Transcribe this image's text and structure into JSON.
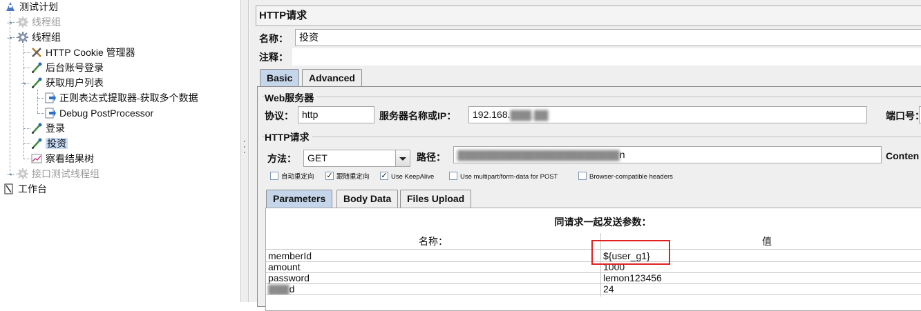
{
  "tree": {
    "items": [
      {
        "label": "测试计划",
        "icon": "test-plan-icon",
        "enabled": true
      },
      {
        "label": "线程组",
        "icon": "thread-group-gear-icon",
        "enabled": false
      },
      {
        "label": "线程组",
        "icon": "thread-group-gear-icon",
        "enabled": true
      },
      {
        "label": "HTTP Cookie 管理器",
        "icon": "config-tools-icon",
        "enabled": true
      },
      {
        "label": "后台账号登录",
        "icon": "sampler-pipette-icon",
        "enabled": true
      },
      {
        "label": "获取用户列表",
        "icon": "sampler-pipette-icon",
        "enabled": true
      },
      {
        "label": "正则表达式提取器-获取多个数据",
        "icon": "post-processor-arrow-icon",
        "enabled": true
      },
      {
        "label": "Debug PostProcessor",
        "icon": "post-processor-arrow-icon",
        "enabled": true
      },
      {
        "label": "登录",
        "icon": "sampler-pipette-icon",
        "enabled": true
      },
      {
        "label": "投资",
        "icon": "sampler-pipette-icon",
        "enabled": true,
        "selected": true
      },
      {
        "label": "察看结果树",
        "icon": "listener-chart-icon",
        "enabled": true
      },
      {
        "label": "接口测试线程组",
        "icon": "thread-group-gear-icon",
        "enabled": false
      },
      {
        "label": "工作台",
        "icon": "workbench-icon",
        "enabled": true
      }
    ]
  },
  "panel": {
    "title": "HTTP请求",
    "name_label": "名称：",
    "name_value": "投资",
    "comment_label": "注释：",
    "tabs": [
      "Basic",
      "Advanced"
    ],
    "web_server": {
      "group_title": "Web服务器",
      "protocol_label": "协议：",
      "protocol_value": "http",
      "server_label": "服务器名称或IP：",
      "server_value": "192.168.",
      "port_label": "端口号："
    },
    "http_request": {
      "group_title": "HTTP请求",
      "method_label": "方法：",
      "method_value": "GET",
      "path_label": "路径：",
      "path_value_tail": "n",
      "content_label": "Conten"
    },
    "checkboxes": [
      {
        "label": "自动重定向",
        "checked": false
      },
      {
        "label": "跟随重定向",
        "checked": true
      },
      {
        "label": "Use KeepAlive",
        "checked": true
      },
      {
        "label": "Use multipart/form-data for POST",
        "checked": false
      },
      {
        "label": "Browser-compatible headers",
        "checked": false
      }
    ],
    "param_tabs": [
      "Parameters",
      "Body Data",
      "Files Upload"
    ],
    "params": {
      "caption": "同请求一起发送参数：",
      "col_name": "名称：",
      "col_value": "值",
      "rows": [
        {
          "name": "memberId",
          "value": "${user_g1}"
        },
        {
          "name": "amount",
          "value": "1000"
        },
        {
          "name": "password",
          "value": "lemon123456"
        },
        {
          "name": "d",
          "value": "24"
        }
      ]
    }
  },
  "colors": {
    "selected_tab": "#c5d6ea",
    "highlight_box": "#e02020",
    "tree_selection": "#c6dbf5"
  }
}
